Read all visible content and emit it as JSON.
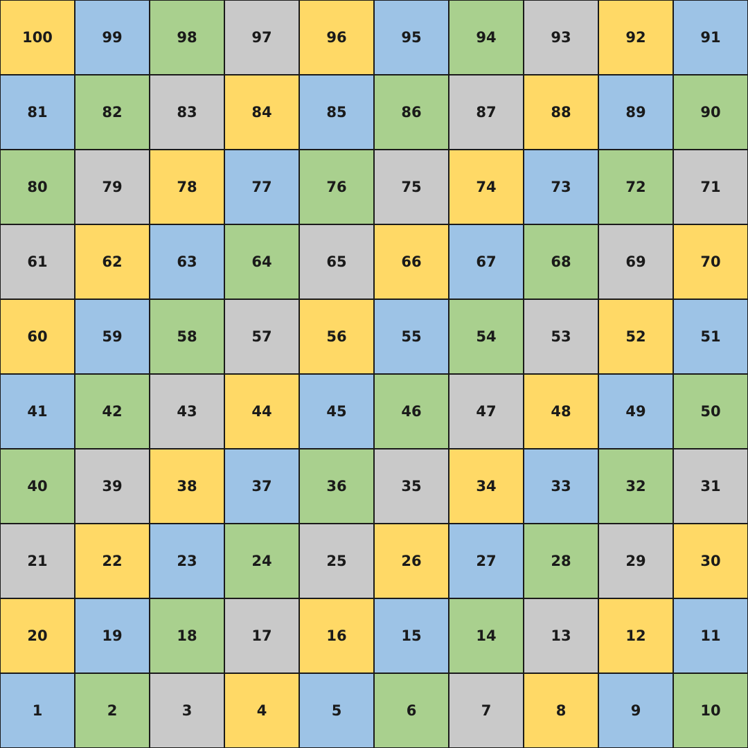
{
  "colors": {
    "yellow": "#FFD966",
    "blue": "#9DC3E6",
    "green": "#A9D08E",
    "gray": "#C9C9C9",
    "grid_line": "#1a1a1a",
    "text": "#1a1a1a"
  },
  "board": {
    "rows": [
      [
        {
          "label": "100",
          "color": "yellow"
        },
        {
          "label": "99",
          "color": "blue"
        },
        {
          "label": "98",
          "color": "green"
        },
        {
          "label": "97",
          "color": "gray"
        },
        {
          "label": "96",
          "color": "yellow"
        },
        {
          "label": "95",
          "color": "blue"
        },
        {
          "label": "94",
          "color": "green"
        },
        {
          "label": "93",
          "color": "gray"
        },
        {
          "label": "92",
          "color": "yellow"
        },
        {
          "label": "91",
          "color": "blue"
        }
      ],
      [
        {
          "label": "81",
          "color": "blue"
        },
        {
          "label": "82",
          "color": "green"
        },
        {
          "label": "83",
          "color": "gray"
        },
        {
          "label": "84",
          "color": "yellow"
        },
        {
          "label": "85",
          "color": "blue"
        },
        {
          "label": "86",
          "color": "green"
        },
        {
          "label": "87",
          "color": "gray"
        },
        {
          "label": "88",
          "color": "yellow"
        },
        {
          "label": "89",
          "color": "blue"
        },
        {
          "label": "90",
          "color": "green"
        }
      ],
      [
        {
          "label": "80",
          "color": "green"
        },
        {
          "label": "79",
          "color": "gray"
        },
        {
          "label": "78",
          "color": "yellow"
        },
        {
          "label": "77",
          "color": "blue"
        },
        {
          "label": "76",
          "color": "green"
        },
        {
          "label": "75",
          "color": "gray"
        },
        {
          "label": "74",
          "color": "yellow"
        },
        {
          "label": "73",
          "color": "blue"
        },
        {
          "label": "72",
          "color": "green"
        },
        {
          "label": "71",
          "color": "gray"
        }
      ],
      [
        {
          "label": "61",
          "color": "gray"
        },
        {
          "label": "62",
          "color": "yellow"
        },
        {
          "label": "63",
          "color": "blue"
        },
        {
          "label": "64",
          "color": "green"
        },
        {
          "label": "65",
          "color": "gray"
        },
        {
          "label": "66",
          "color": "yellow"
        },
        {
          "label": "67",
          "color": "blue"
        },
        {
          "label": "68",
          "color": "green"
        },
        {
          "label": "69",
          "color": "gray"
        },
        {
          "label": "70",
          "color": "yellow"
        }
      ],
      [
        {
          "label": "60",
          "color": "yellow"
        },
        {
          "label": "59",
          "color": "blue"
        },
        {
          "label": "58",
          "color": "green"
        },
        {
          "label": "57",
          "color": "gray"
        },
        {
          "label": "56",
          "color": "yellow"
        },
        {
          "label": "55",
          "color": "blue"
        },
        {
          "label": "54",
          "color": "green"
        },
        {
          "label": "53",
          "color": "gray"
        },
        {
          "label": "52",
          "color": "yellow"
        },
        {
          "label": "51",
          "color": "blue"
        }
      ],
      [
        {
          "label": "41",
          "color": "blue"
        },
        {
          "label": "42",
          "color": "green"
        },
        {
          "label": "43",
          "color": "gray"
        },
        {
          "label": "44",
          "color": "yellow"
        },
        {
          "label": "45",
          "color": "blue"
        },
        {
          "label": "46",
          "color": "green"
        },
        {
          "label": "47",
          "color": "gray"
        },
        {
          "label": "48",
          "color": "yellow"
        },
        {
          "label": "49",
          "color": "blue"
        },
        {
          "label": "50",
          "color": "green"
        }
      ],
      [
        {
          "label": "40",
          "color": "green"
        },
        {
          "label": "39",
          "color": "gray"
        },
        {
          "label": "38",
          "color": "yellow"
        },
        {
          "label": "37",
          "color": "blue"
        },
        {
          "label": "36",
          "color": "green"
        },
        {
          "label": "35",
          "color": "gray"
        },
        {
          "label": "34",
          "color": "yellow"
        },
        {
          "label": "33",
          "color": "blue"
        },
        {
          "label": "32",
          "color": "green"
        },
        {
          "label": "31",
          "color": "gray"
        }
      ],
      [
        {
          "label": "21",
          "color": "gray"
        },
        {
          "label": "22",
          "color": "yellow"
        },
        {
          "label": "23",
          "color": "blue"
        },
        {
          "label": "24",
          "color": "green"
        },
        {
          "label": "25",
          "color": "gray"
        },
        {
          "label": "26",
          "color": "yellow"
        },
        {
          "label": "27",
          "color": "blue"
        },
        {
          "label": "28",
          "color": "green"
        },
        {
          "label": "29",
          "color": "gray"
        },
        {
          "label": "30",
          "color": "yellow"
        }
      ],
      [
        {
          "label": "20",
          "color": "yellow"
        },
        {
          "label": "19",
          "color": "blue"
        },
        {
          "label": "18",
          "color": "green"
        },
        {
          "label": "17",
          "color": "gray"
        },
        {
          "label": "16",
          "color": "yellow"
        },
        {
          "label": "15",
          "color": "blue"
        },
        {
          "label": "14",
          "color": "green"
        },
        {
          "label": "13",
          "color": "gray"
        },
        {
          "label": "12",
          "color": "yellow"
        },
        {
          "label": "11",
          "color": "blue"
        }
      ],
      [
        {
          "label": "1",
          "color": "blue"
        },
        {
          "label": "2",
          "color": "green"
        },
        {
          "label": "3",
          "color": "gray"
        },
        {
          "label": "4",
          "color": "yellow"
        },
        {
          "label": "5",
          "color": "blue"
        },
        {
          "label": "6",
          "color": "green"
        },
        {
          "label": "7",
          "color": "gray"
        },
        {
          "label": "8",
          "color": "yellow"
        },
        {
          "label": "9",
          "color": "blue"
        },
        {
          "label": "10",
          "color": "green"
        }
      ]
    ]
  }
}
